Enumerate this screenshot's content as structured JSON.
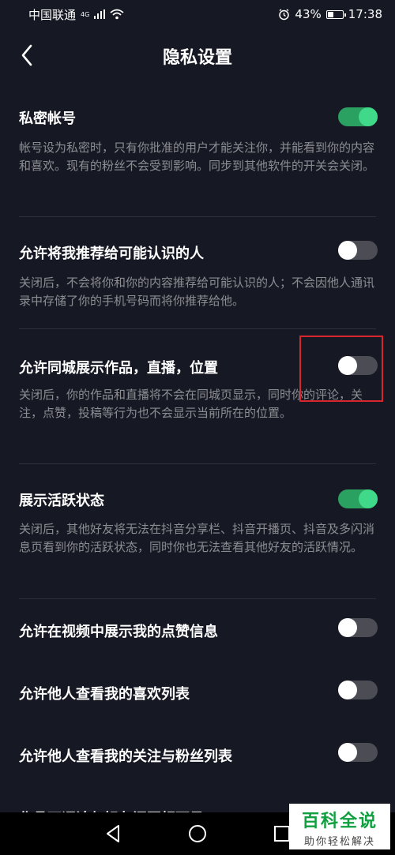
{
  "status_bar": {
    "carrier": "中国联通",
    "network": "4G",
    "battery_percent_text": "43%",
    "battery_level": 0.43,
    "time": "17:38",
    "icons": [
      "signal-icon",
      "wifi-icon",
      "alarm-icon",
      "battery-icon"
    ]
  },
  "header": {
    "title": "隐私设置",
    "back_icon": "chevron-left-icon"
  },
  "settings": [
    {
      "title": "私密帐号",
      "description": "帐号设为私密时，只有你批准的用户才能关注你，并能看到你的内容和喜欢。现有的粉丝不会受到影响。同步到其他软件的开关会关闭。",
      "enabled": true
    },
    {
      "title": "允许将我推荐给可能认识的人",
      "description": "关闭后，不会将你和你的内容推荐给可能认识的人；不会因他人通讯录中存储了你的手机号码而将你推荐给他。",
      "enabled": false
    },
    {
      "title": "允许同城展示作品，直播，位置",
      "description": "关闭后，你的作品和直播将不会在同城页显示，同时你的评论，关注，点赞，投稿等行为也不会显示当前所在的位置。",
      "enabled": false
    },
    {
      "title": "展示活跃状态",
      "description": "关闭后，其他好友将无法在抖音分享栏、抖音开播页、抖音及多闪消息页看到你的活跃状态，同时你也无法查看其他好友的活跃情况。",
      "enabled": true
    },
    {
      "title": "允许在视频中展示我的点赞信息",
      "enabled": false
    },
    {
      "title": "允许他人查看我的喜欢列表",
      "enabled": false
    },
    {
      "title": "允许他人查看我的关注与粉丝列表",
      "enabled": false
    },
    {
      "title": "作品下评论仅好友间互相可见",
      "enabled": false
    }
  ],
  "colors": {
    "background": "#161823",
    "toggle_on": "#40d989",
    "toggle_off": "#4b4c54",
    "highlight": "#d9252e"
  },
  "system_nav": {
    "icons": [
      "back-triangle-icon",
      "home-circle-icon",
      "recents-square-icon"
    ]
  },
  "watermark": {
    "title": "百科全说",
    "subtitle": "助你轻松解决"
  }
}
